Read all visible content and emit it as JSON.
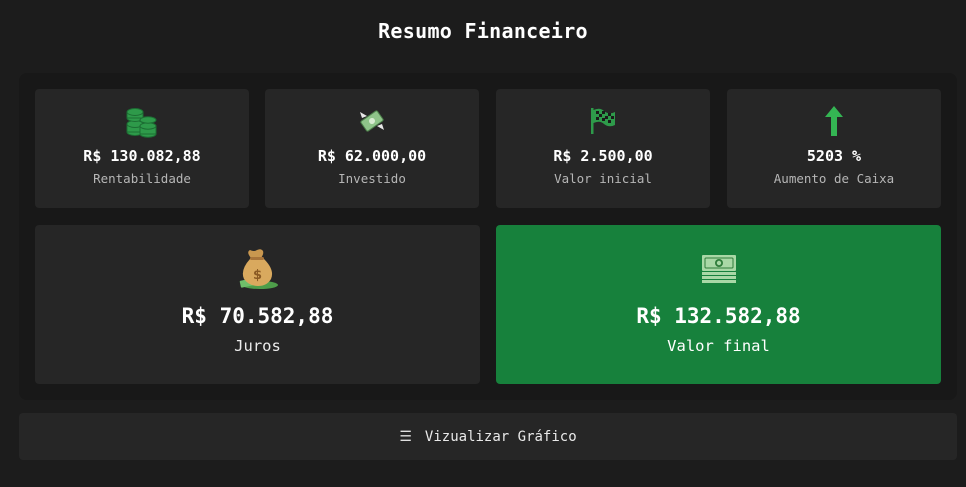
{
  "header": {
    "title": "Resumo Financeiro"
  },
  "summary_cards": [
    {
      "icon": "coins-stack-icon",
      "value": "R$ 130.082,88",
      "label": "Rentabilidade"
    },
    {
      "icon": "money-with-wings-icon",
      "value": "R$ 62.000,00",
      "label": "Investido"
    },
    {
      "icon": "checkered-flag-icon",
      "value": "R$ 2.500,00",
      "label": "Valor inicial"
    },
    {
      "icon": "arrow-up-icon",
      "value": "5203 %",
      "label": "Aumento de Caixa"
    }
  ],
  "highlight_cards": [
    {
      "icon": "money-bag-icon",
      "value": "R$ 70.582,88",
      "label": "Juros"
    },
    {
      "icon": "banknotes-stack-icon",
      "value": "R$ 132.582,88",
      "label": "Valor final"
    }
  ],
  "chart_button": {
    "icon": "hamburger-icon",
    "label": "Vizualizar Gráfico"
  },
  "colors": {
    "accent_green": "#17813c",
    "icon_green": "#2ea44f",
    "card_bg": "#262626",
    "page_bg": "#1c1c1c"
  }
}
